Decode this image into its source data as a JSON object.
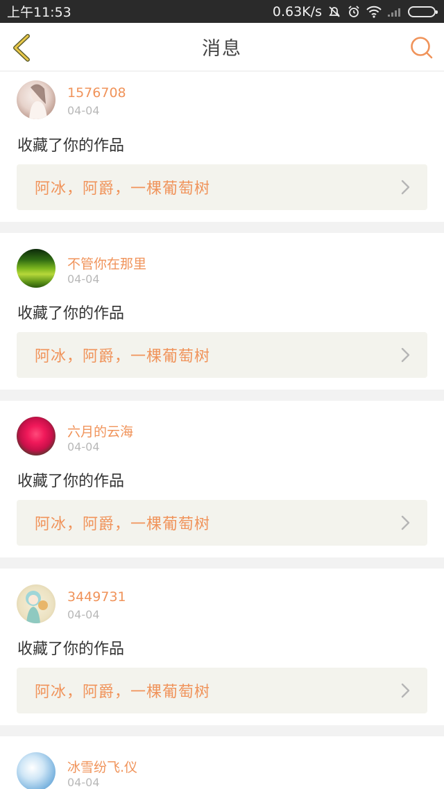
{
  "status_bar": {
    "time": "上午11:53",
    "speed": "0.63K/s"
  },
  "header": {
    "title": "消息",
    "back_icon": "chevron-left-icon",
    "search_icon": "search-icon",
    "accent_color": "#f0935a"
  },
  "messages": [
    {
      "username": "1576708",
      "date": "04-04",
      "action": "收藏了你的作品",
      "work_title": "阿冰，阿爵，一棵葡萄树"
    },
    {
      "username": "不管你在那里",
      "date": "04-04",
      "action": "收藏了你的作品",
      "work_title": "阿冰，阿爵，一棵葡萄树"
    },
    {
      "username": "六月的云海",
      "date": "04-04",
      "action": "收藏了你的作品",
      "work_title": "阿冰，阿爵，一棵葡萄树"
    },
    {
      "username": "3449731",
      "date": "04-04",
      "action": "收藏了你的作品",
      "work_title": "阿冰，阿爵，一棵葡萄树"
    },
    {
      "username": "冰雪纷飞.仪",
      "date": "04-04"
    }
  ]
}
